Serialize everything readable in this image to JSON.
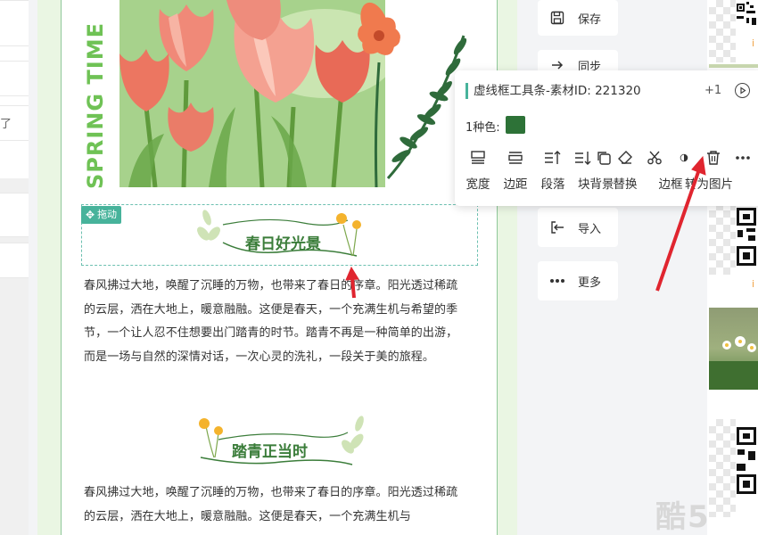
{
  "left_panel": {
    "cut_text": "了"
  },
  "document": {
    "side_title": "SPRING TIME",
    "drag_label": "拖动",
    "section1": {
      "heading": "春日好光景",
      "paragraph": "春风拂过大地，唤醒了沉睡的万物，也带来了春日的序章。阳光透过稀疏的云层，洒在大地上，暖意融融。这便是春天，一个充满生机与希望的季节，一个让人忍不住想要出门踏青的时节。踏青不再是一种简单的出游，而是一场与自然的深情对话，一次心灵的洗礼，一段关于美的旅程。"
    },
    "section2": {
      "heading": "踏青正当时",
      "paragraph": "春风拂过大地，唤醒了沉睡的万物，也带来了春日的序章。阳光透过稀疏的云层，洒在大地上，暖意融融。这便是春天，一个充满生机与"
    }
  },
  "right_toolbar": [
    {
      "label": "保存",
      "icon": "save-icon"
    },
    {
      "label": "同步",
      "icon": "share-icon"
    },
    {
      "label": "导入",
      "icon": "import-icon"
    },
    {
      "label": "更多",
      "icon": "more-icon"
    }
  ],
  "popup": {
    "title": "虚线框工具条-素材ID: 221320",
    "plus": "+1",
    "color_label": "1种色:",
    "swatch_color": "#2d7237",
    "tools": [
      {
        "label": "宽度",
        "icon": "width-icon"
      },
      {
        "label": "边距",
        "icon": "margin-icon"
      },
      {
        "label": "段落",
        "icon": "paragraph-spacing-icon"
      },
      {
        "label": "块背景",
        "icon": "block-background-icon"
      },
      {
        "label": "替换",
        "icon": "replace-icon"
      },
      {
        "label": "边框",
        "icon": "border-icon"
      },
      {
        "label": "转为图片",
        "icon": "convert-image-icon"
      },
      {
        "label": "",
        "icon": "delete-icon"
      },
      {
        "label": "",
        "icon": "more-dots-icon"
      }
    ]
  },
  "materials": {
    "mark": "i"
  },
  "watermark": "酷5",
  "colors": {
    "accent": "#47b39b",
    "heading_green": "#3b7d3a",
    "title_green": "#6fc255",
    "arrow_red": "#e0252f"
  }
}
